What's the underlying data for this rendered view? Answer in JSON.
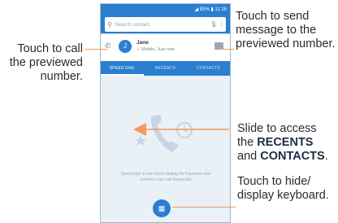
{
  "callouts": {
    "call": "Touch to call the previewed number.",
    "message": "Touch to send message to the previewed number.",
    "slide_prefix": "Slide to access the ",
    "slide_recents": "RECENTS",
    "slide_and": " and ",
    "slide_contacts": "CONTACTS",
    "slide_suffix": ".",
    "keyboard": "Touch to hide/ display keyboard."
  },
  "phone": {
    "status_text": "◢ 85% ▮ 11:16",
    "search_placeholder": "Search contact",
    "preview": {
      "name": "Jane",
      "sub": "✓ Mobile, Just now",
      "avatar_initial": "J"
    },
    "tabs": [
      {
        "label": "SPEED DIAL",
        "active": true
      },
      {
        "label": "RECENTS",
        "active": false
      },
      {
        "label": "CONTACTS",
        "active": false
      }
    ],
    "empty_message": "Speed dial is one touch dialing for Favorites and numbers you call frequently",
    "fab_icon": "dialpad-icon"
  },
  "colors": {
    "accent": "#2a7fd1",
    "callout_line": "#f09a5c"
  }
}
